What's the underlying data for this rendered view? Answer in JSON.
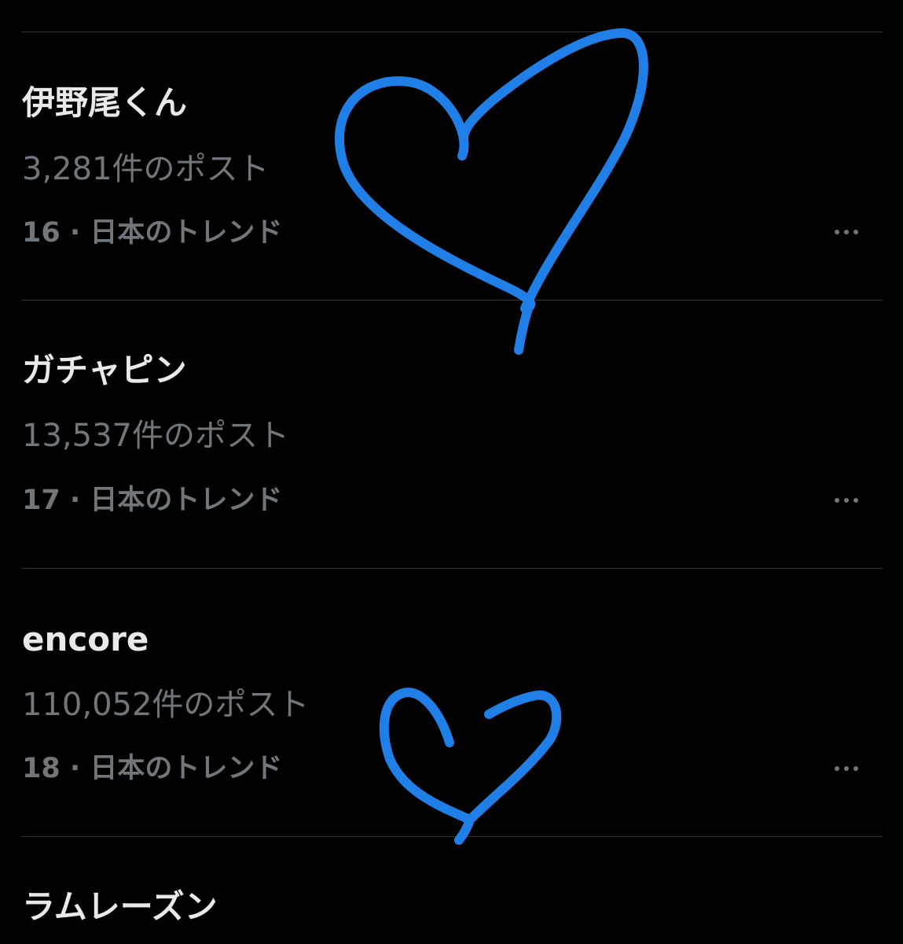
{
  "trends": [
    {
      "title": "伊野尾くん",
      "count": "3,281件のポスト",
      "context": "16 · 日本のトレンド",
      "more_icon": "more-horizontal-icon"
    },
    {
      "title": "ガチャピン",
      "count": "13,537件のポスト",
      "context": "17 · 日本のトレンド",
      "more_icon": "more-horizontal-icon"
    },
    {
      "title": "encore",
      "count": "110,052件のポスト",
      "context": "18 · 日本のトレンド",
      "more_icon": "more-horizontal-icon"
    },
    {
      "title": "ラムレーズン"
    }
  ],
  "colors": {
    "background": "#000000",
    "title_text": "#e7e9ea",
    "secondary_text": "#71767b",
    "divider": "#2f3336",
    "doodle_heart": "#1f7fe6"
  }
}
